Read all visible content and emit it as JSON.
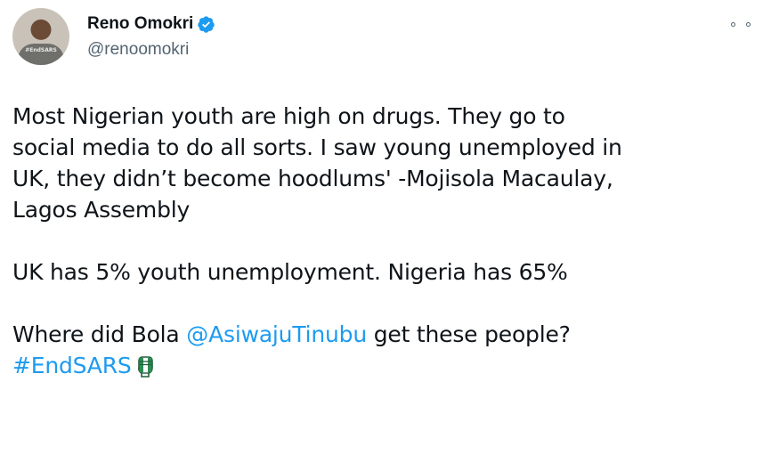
{
  "tweet": {
    "author": {
      "display_name": "Reno Omokri",
      "handle": "@renoomokri",
      "avatar_shirt_text": "#EndSARS",
      "verified": true
    },
    "more_icon": "more-options-icon",
    "body": {
      "paragraph_1": "Most Nigerian youth are high on drugs. They go to\nsocial media to do all sorts. I saw young unemployed in\nUK, they didn’t become hoodlums' -Mojisola Macaulay,\nLagos Assembly",
      "paragraph_2": "UK has 5% youth unemployment. Nigeria has 65%",
      "paragraph_3_prefix": "Where did Bola ",
      "mention": "@AsiwajuTinubu",
      "paragraph_3_suffix": " get these people?",
      "hashtag": "#EndSARS"
    },
    "colors": {
      "link": "#1d9bf0",
      "verified": "#1d9bf0",
      "secondary_text": "#536471",
      "flag_green": "#2e8b57"
    }
  }
}
